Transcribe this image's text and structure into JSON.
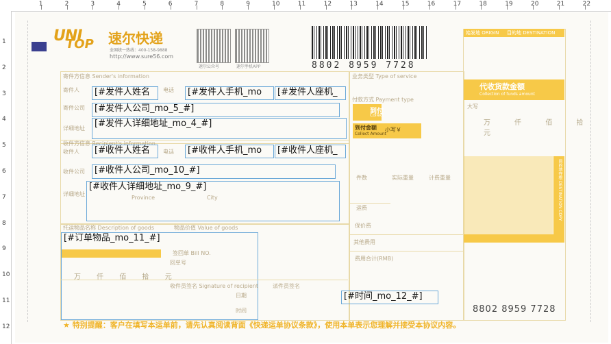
{
  "ruler": {
    "numbers": [
      "1",
      "2",
      "3",
      "4",
      "5",
      "6",
      "7",
      "8",
      "9",
      "10",
      "11",
      "12",
      "13",
      "14",
      "15",
      "16",
      "17",
      "18",
      "19",
      "20",
      "21",
      "22"
    ],
    "left_numbers": [
      "1",
      "2",
      "3",
      "4",
      "5",
      "6",
      "7",
      "8",
      "9",
      "10",
      "11",
      "12"
    ]
  },
  "header": {
    "logo_uni": "UNI",
    "logo_top": "TOP",
    "brand_name": "速尔快递",
    "hotline": "全国统一热线：400-158-9888",
    "website": "http://www.sure56.com",
    "qr1_caption": "速尔公众号",
    "qr2_caption": "速尔手机APP",
    "waybill_number": "8802 8959 7728"
  },
  "sender": {
    "section_title": "寄件方信息 Sender's information",
    "name_label": "寄件人",
    "phone_label": "电话",
    "company_label": "寄件公司",
    "address_label": "详细地址",
    "name_field": "[#发件人姓名",
    "mobile_field": "[#发件人手机_mo",
    "landline_field": "[#发件人座机_",
    "company_field": "[#发件人公司_mo_5_#]",
    "address_field": "[#发件人详细地址_mo_4_#]"
  },
  "recipient": {
    "section_title": "收件方信息 Recipient's information",
    "name_label": "收件人",
    "phone_label": "电话",
    "company_label": "收件公司",
    "address_label": "详细地址",
    "province_label": "Province",
    "city_label": "City",
    "name_field": "[#收件人姓名",
    "mobile_field": "[#收件人手机_mo",
    "landline_field": "[#收件人座机_",
    "company_field": "[#收件人公司_mo_10_#]",
    "address_field": "[#收件人详细地址_mo_9_#]"
  },
  "goods": {
    "section_title": "托运物品名称 Description of goods",
    "value_title": "物品价值 Value of goods",
    "goods_field": "[#订单物品_mo_11_#]",
    "insure_words": "万 仟 佰 拾 元",
    "sign_bill": "签回单 Bill NO.",
    "bill_no": "回单号"
  },
  "service": {
    "type_label": "业务类型 Type of service",
    "payment_label": "付款方式 Payment type",
    "collect_label": "到付",
    "collect_en": "Collect",
    "collect_amount": "到付金额",
    "collect_amount_en": "Collect Amount",
    "small_write": "小写￥",
    "pieces_label": "件数",
    "weight_label": "实际重量",
    "volume_label": "计费重量",
    "freight_label": "运费",
    "insurance_label": "保价费",
    "other_label": "其他费用",
    "total_label": "费用合计(RMB)",
    "courier_sign": "收件员签名 Signature of recipient",
    "delivery_sign": "派件员签名",
    "date_label": "日期",
    "time_label": "时间"
  },
  "cod": {
    "title": "代收货款金额",
    "subtitle": "Collection of funds amount",
    "upper_label": "大写",
    "words": "万 仟 佰 拾 元",
    "destination": "目的地 DESTINATION",
    "origin": "始发地 ORIGIN",
    "copy_label": "目的地存根 DESTINATION COPY"
  },
  "time_field": "[#时间_mo_12_#]",
  "footer": {
    "notice": "特别提醒：客户在填写本运单前，请先认真阅读背面《快递运单协议条款》，使用本单表示您理解并接受本协议内容。",
    "waybill_number": "8802 8959 7728"
  }
}
